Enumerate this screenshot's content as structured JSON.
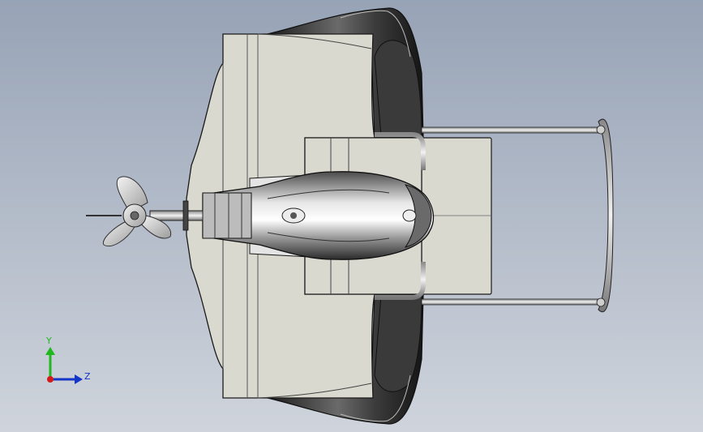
{
  "triad": {
    "y_label": "Y",
    "z_label": "Z",
    "colors": {
      "y_axis": "#1fb81f",
      "z_axis": "#1436c8",
      "origin": "#d21a1a"
    }
  },
  "colors": {
    "background_top": "#9aa6b8",
    "background_bottom": "#c9cfd8",
    "housing_fill": "#d9d8cc",
    "rim_dark": "#2a2a2a",
    "metal_light": "#dcdcdc",
    "metal_dark": "#505050",
    "outline": "#1a1a1a"
  }
}
